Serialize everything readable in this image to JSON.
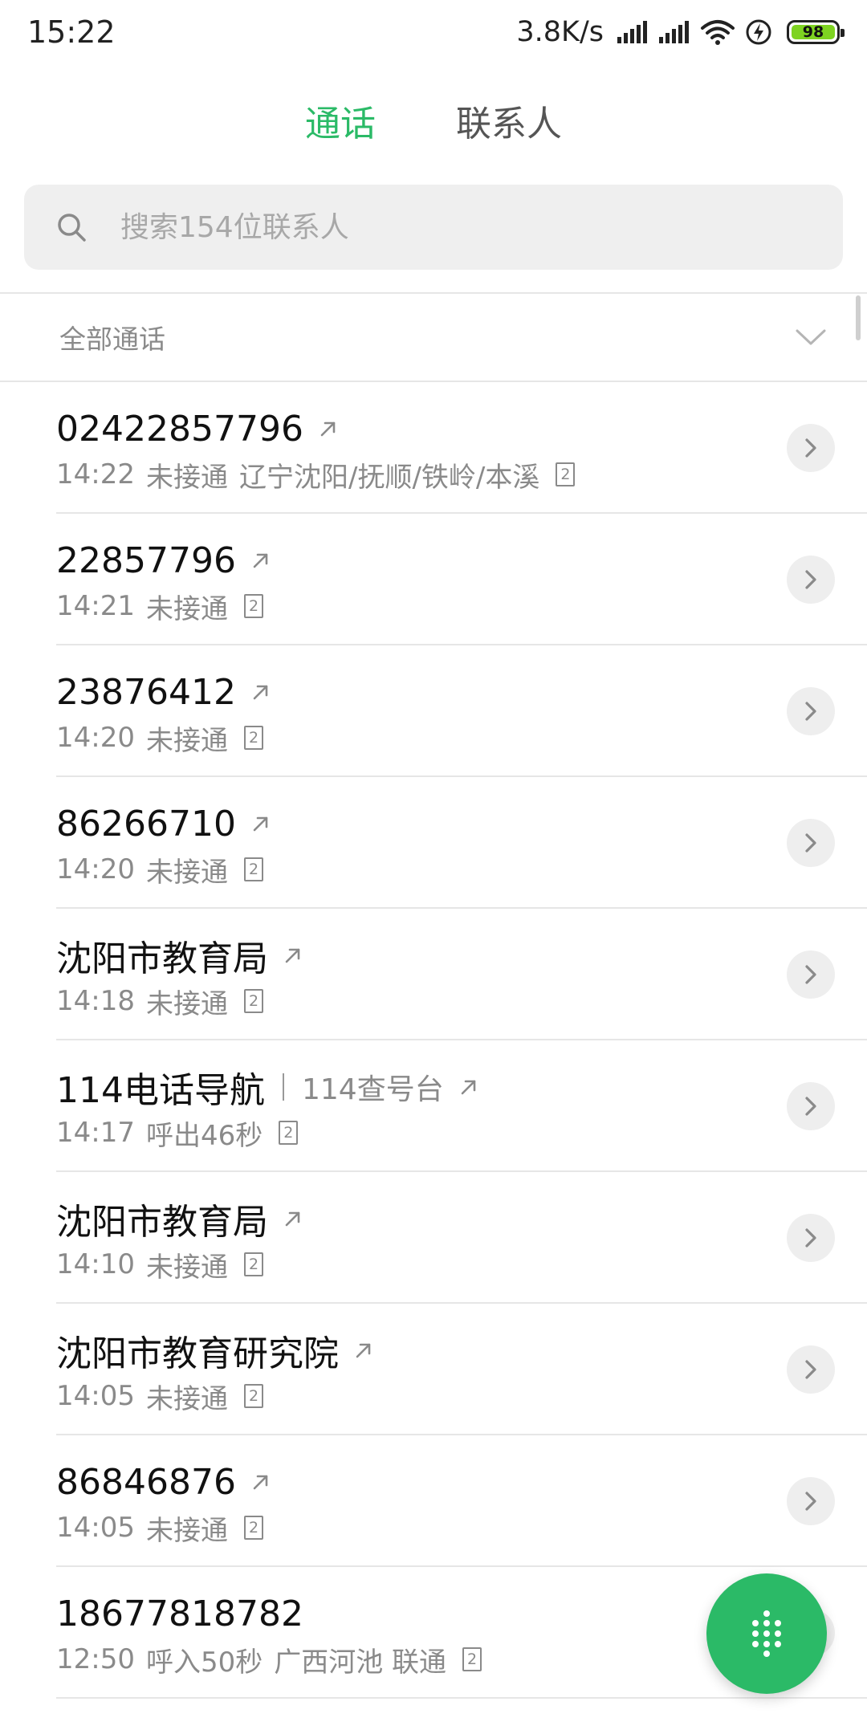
{
  "status_bar": {
    "time": "15:22",
    "net_speed": "3.8K/s",
    "battery": "98",
    "icons": [
      "signal-icon",
      "signal-icon",
      "wifi-icon",
      "charging-icon",
      "battery-icon"
    ]
  },
  "tabs": [
    {
      "label": "通话",
      "active": true
    },
    {
      "label": "联系人",
      "active": false
    }
  ],
  "search": {
    "placeholder": "搜索154位联系人",
    "icon": "search-icon"
  },
  "filter": {
    "label": "全部通话",
    "icon": "chevron-down-icon"
  },
  "calls": [
    {
      "name": "02422857796",
      "time": "14:22",
      "status": "未接通",
      "location": "辽宁沈阳/抚顺/铁岭/本溪",
      "sim": "2",
      "outgoing": true
    },
    {
      "name": "22857796",
      "time": "14:21",
      "status": "未接通",
      "location": "",
      "sim": "2",
      "outgoing": true
    },
    {
      "name": "23876412",
      "time": "14:20",
      "status": "未接通",
      "location": "",
      "sim": "2",
      "outgoing": true
    },
    {
      "name": "86266710",
      "time": "14:20",
      "status": "未接通",
      "location": "",
      "sim": "2",
      "outgoing": true
    },
    {
      "name": "沈阳市教育局",
      "time": "14:18",
      "status": "未接通",
      "location": "",
      "sim": "2",
      "outgoing": true
    },
    {
      "name": "114电话导航",
      "subtitle": "114查号台",
      "time": "14:17",
      "status": "呼出46秒",
      "location": "",
      "sim": "2",
      "outgoing": true
    },
    {
      "name": "沈阳市教育局",
      "time": "14:10",
      "status": "未接通",
      "location": "",
      "sim": "2",
      "outgoing": true
    },
    {
      "name": "沈阳市教育研究院",
      "time": "14:05",
      "status": "未接通",
      "location": "",
      "sim": "2",
      "outgoing": true
    },
    {
      "name": "86846876",
      "time": "14:05",
      "status": "未接通",
      "location": "",
      "sim": "2",
      "outgoing": true
    },
    {
      "name": "18677818782",
      "time": "12:50",
      "status": "呼入50秒",
      "location": "广西河池 联通",
      "sim": "2",
      "outgoing": false
    }
  ],
  "fab": {
    "icon": "dialpad-icon"
  },
  "colors": {
    "accent": "#2bba67",
    "secondary_text": "#8a8a8a",
    "battery": "#7ed321"
  }
}
